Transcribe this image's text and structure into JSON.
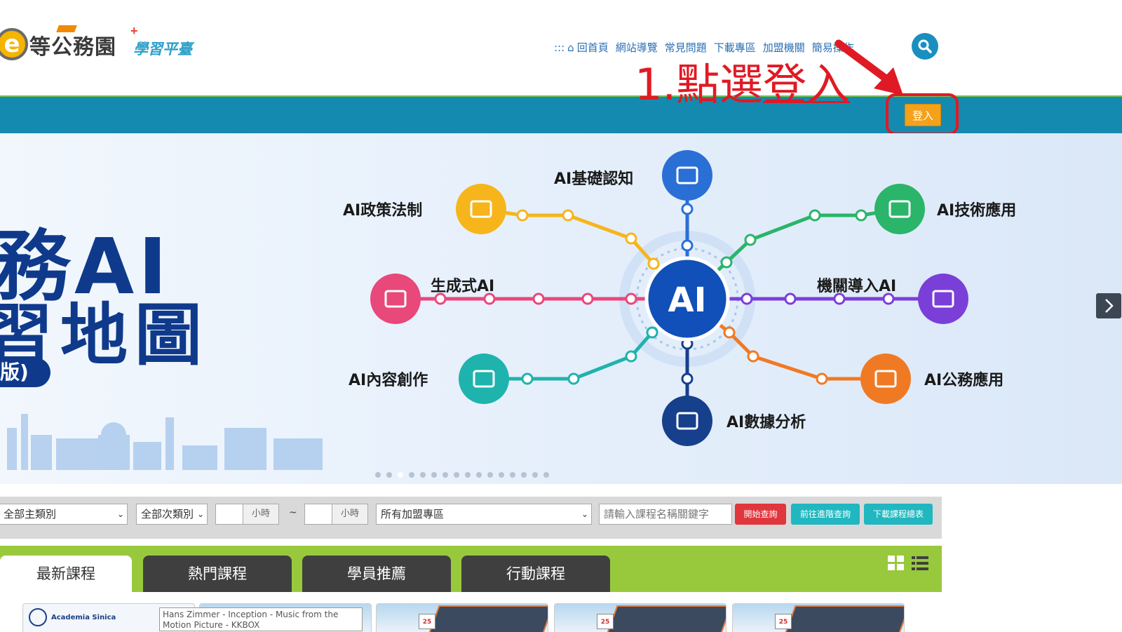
{
  "header": {
    "logo_letter": "e",
    "logo_main": "等公務園",
    "logo_plus": "+",
    "logo_sub": "學習平臺",
    "nav_prefix": ":::",
    "nav": [
      "回首頁",
      "網站導覽",
      "常見問題",
      "下載專區",
      "加盟機關",
      "簡易操作"
    ]
  },
  "annotation": {
    "step_num": "1.",
    "step_text_a": "點選",
    "step_text_b": "登入"
  },
  "login_label": "登入",
  "banner": {
    "title_line1": "務AI",
    "title_line2": "習地圖",
    "pill": "版)",
    "hub": "AI",
    "nodes": [
      {
        "label": "AI基礎認知",
        "color": "#2a6fd6",
        "icon": "book-icon"
      },
      {
        "label": "AI技術應用",
        "color": "#2ab56a",
        "icon": "chart-icon"
      },
      {
        "label": "機關導入AI",
        "color": "#7a3fd8",
        "icon": "laptop-icon"
      },
      {
        "label": "AI公務應用",
        "color": "#f07a23",
        "icon": "people-icon"
      },
      {
        "label": "AI數據分析",
        "color": "#163f8c",
        "icon": "graduation-cap-icon"
      },
      {
        "label": "AI內容創作",
        "color": "#1fb3ad",
        "icon": "chat-icon"
      },
      {
        "label": "生成式AI",
        "color": "#e8487a",
        "icon": "target-icon"
      },
      {
        "label": "AI政策法制",
        "color": "#f7b51c",
        "icon": "lightbulb-icon"
      }
    ],
    "slide_count": 16,
    "active_slide": 2
  },
  "filter": {
    "main_category": "全部主類別",
    "sub_category": "全部次類別",
    "hour_unit": "小時",
    "range_sep": "~",
    "zone": "所有加盟專區",
    "keyword_placeholder": "請輸入課程名稱關鍵字",
    "btn_search": "開始查詢",
    "btn_advanced": "前往進階查詢",
    "btn_download": "下載課程總表",
    "colors": {
      "search": "#e0363c",
      "advanced": "#20b7c0",
      "download": "#20b7c0"
    }
  },
  "tabs": [
    "最新課程",
    "熱門課程",
    "學員推薦",
    "行動課程"
  ],
  "cards": {
    "first_org": "Academia Sinica",
    "tooltip": "Hans Zimmer - Inception - Music from the Motion Picture - KKBOX",
    "cal_day": "25"
  }
}
